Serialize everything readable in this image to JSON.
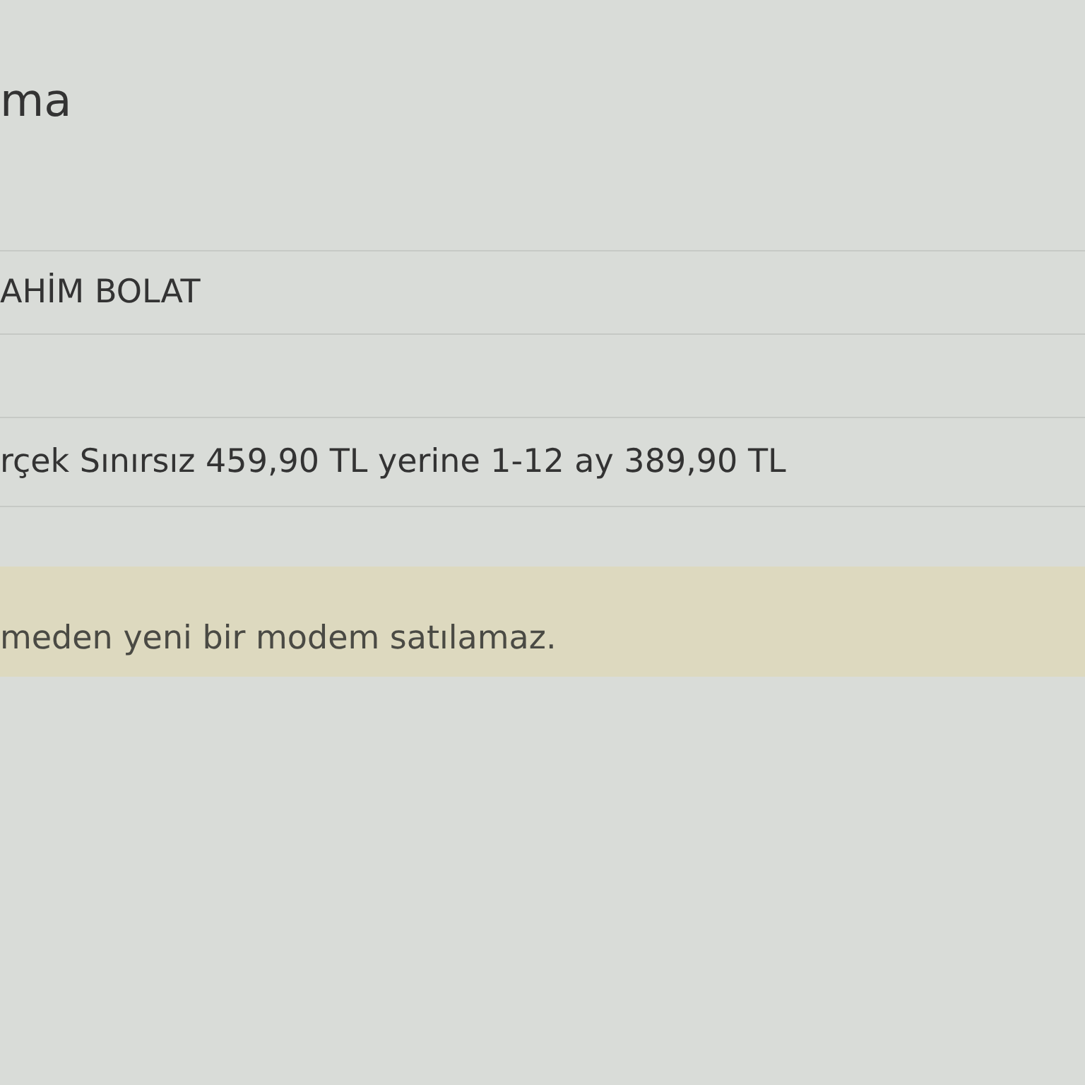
{
  "title": "ma",
  "rows": [
    {
      "value": "AHİM BOLAT"
    },
    {
      "value": "rçek Sınırsız 459,90 TL yerine 1-12 ay 389,90 TL"
    }
  ],
  "warning": {
    "text": "meden yeni bir modem satılamaz."
  }
}
